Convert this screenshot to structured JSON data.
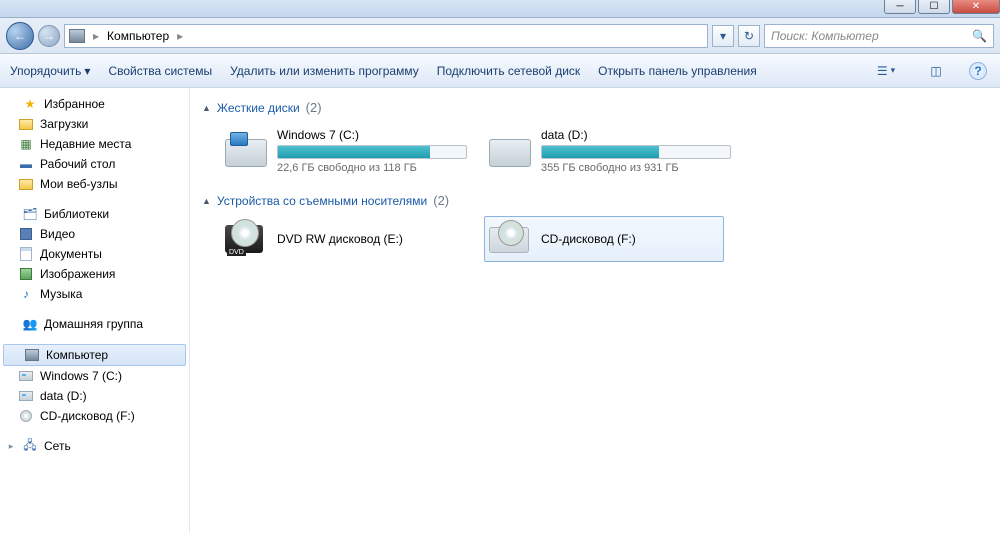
{
  "breadcrumb": {
    "root": "Компьютер"
  },
  "search": {
    "placeholder": "Поиск: Компьютер"
  },
  "toolbar": {
    "organize": "Упорядочить",
    "properties": "Свойства системы",
    "uninstall": "Удалить или изменить программу",
    "mapdrive": "Подключить сетевой диск",
    "controlpanel": "Открыть панель управления"
  },
  "sidebar": {
    "favorites": "Избранное",
    "downloads": "Загрузки",
    "recent": "Недавние места",
    "desktop": "Рабочий стол",
    "websites": "Мои веб-узлы",
    "libraries": "Библиотеки",
    "videos": "Видео",
    "documents": "Документы",
    "pictures": "Изображения",
    "music": "Музыка",
    "homegroup": "Домашняя группа",
    "computer": "Компьютер",
    "drive_c": "Windows 7 (C:)",
    "drive_d": "data (D:)",
    "drive_f": "CD-дисковод (F:)",
    "network": "Сеть"
  },
  "sections": {
    "hdd": {
      "title": "Жесткие диски",
      "count": "(2)"
    },
    "removable": {
      "title": "Устройства со съемными носителями",
      "count": "(2)"
    }
  },
  "drives": {
    "c": {
      "name": "Windows 7 (C:)",
      "sub": "22,6 ГБ свободно из 118 ГБ",
      "fill_pct": 81
    },
    "d": {
      "name": "data (D:)",
      "sub": "355 ГБ свободно из 931 ГБ",
      "fill_pct": 62
    },
    "e": {
      "name": "DVD RW дисковод (E:)",
      "badge": "DVD"
    },
    "f": {
      "name": "CD-дисковод (F:)"
    }
  }
}
